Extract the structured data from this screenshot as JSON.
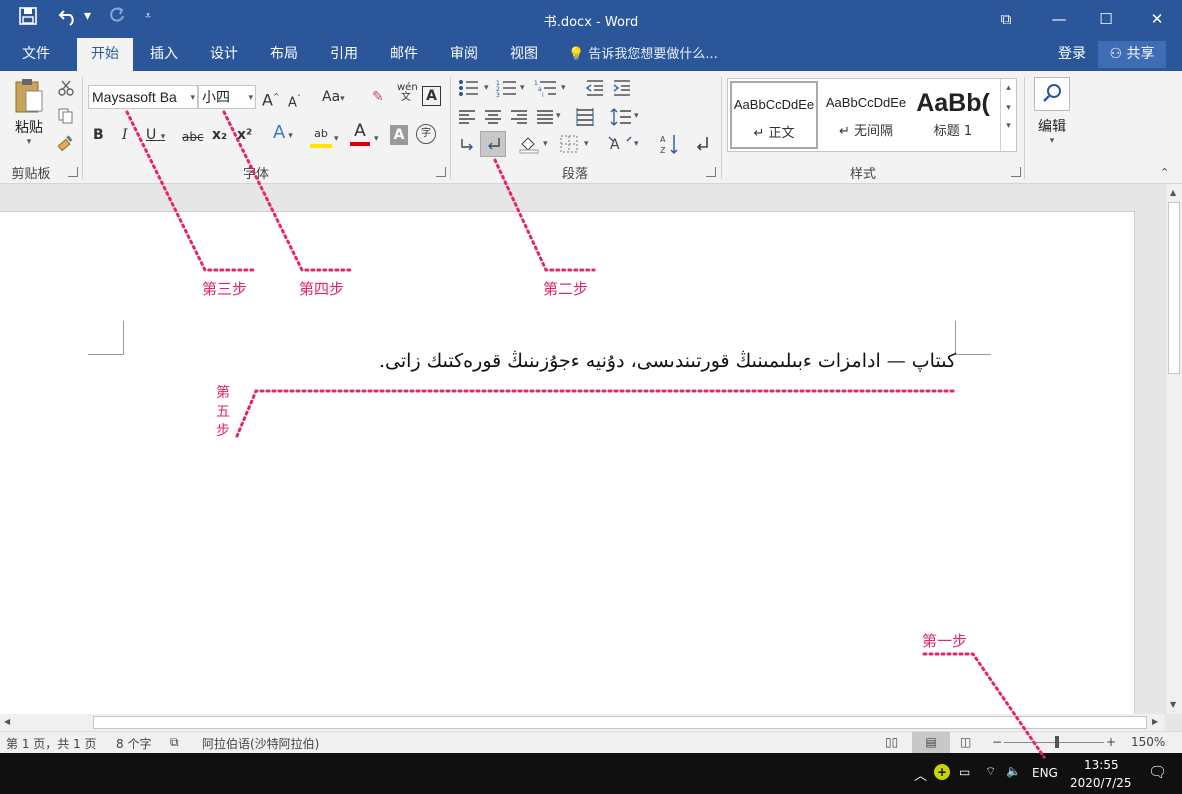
{
  "window": {
    "title": "书.docx - Word",
    "minimize": "—",
    "maximize": "☐",
    "close": "✕",
    "ribbon_display": "⧉"
  },
  "quick_access": {
    "save_icon": "save-icon",
    "undo_icon": "undo-icon",
    "redo_icon": "redo-icon",
    "customize_icon": "customize-icon"
  },
  "tabs": [
    "文件",
    "开始",
    "插入",
    "设计",
    "布局",
    "引用",
    "邮件",
    "审阅",
    "视图"
  ],
  "tell_me": "告诉我您想要做什么...",
  "login": "登录",
  "share": "共享",
  "ribbon": {
    "clipboard": {
      "paste": "粘贴",
      "label": "剪贴板"
    },
    "font": {
      "font_name": "Maysasoft Ba",
      "font_size": "小四",
      "label": "字体",
      "bold": "B",
      "italic": "I",
      "underline": "U",
      "strike": "abc",
      "subscript": "x₂",
      "superscript": "x²",
      "change_case": "Aa",
      "grow": "A",
      "shrink": "A",
      "phonetic": "wén",
      "border_char": "A",
      "text_effect": "A",
      "highlight": "ab",
      "font_color": "A",
      "shading": "A",
      "enclose": "字"
    },
    "paragraph": {
      "label": "段落"
    },
    "styles": {
      "label": "样式",
      "items": [
        {
          "preview": "AaBbCcDdEe",
          "name": "↵ 正文"
        },
        {
          "preview": "AaBbCcDdEe",
          "name": "↵ 无间隔"
        },
        {
          "preview": "AaBb(",
          "name": "标题 1"
        }
      ]
    },
    "editing": {
      "label": "编辑"
    }
  },
  "document": {
    "text": "كىتاپ — ادامزات ءبىلىمىنىڭ قورتىندىسى، دۇنيە ءجۇزىنىڭ قورەكتىك زاتى."
  },
  "annotations": {
    "step1": "第一步",
    "step2": "第二步",
    "step3": "第三步",
    "step4": "第四步",
    "step5": [
      "第",
      "五",
      "步"
    ]
  },
  "statusbar": {
    "page": "第 1 页，共 1 页",
    "words": "8 个字",
    "language": "阿拉伯语(沙特阿拉伯)",
    "zoom": "150%",
    "zoom_minus": "−",
    "zoom_plus": "+"
  },
  "taskbar": {
    "ime": "ENG",
    "time": "13:55",
    "date": "2020/7/25"
  }
}
